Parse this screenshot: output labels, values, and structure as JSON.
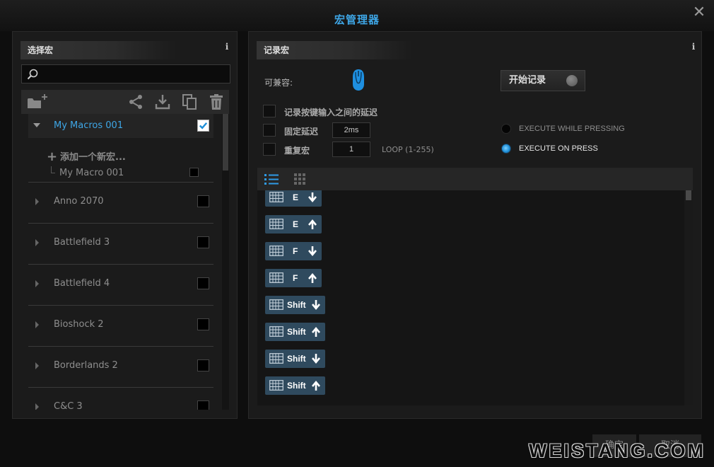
{
  "window": {
    "title": "宏管理器",
    "close": "✕"
  },
  "left": {
    "header": "选择宏",
    "info": "i",
    "search": {
      "value": "",
      "placeholder": ""
    },
    "group": {
      "label": "My Macros 001",
      "checked": true
    },
    "add_macro": "添加一个新宏...",
    "sub_macro": "My Macro 001",
    "games": [
      "Anno 2070",
      "Battlefield 3",
      "Battlefield 4",
      "Bioshock 2",
      "Borderlands 2",
      "C&C 3"
    ]
  },
  "right": {
    "header": "记录宏",
    "info": "i",
    "compat_label": "可兼容:",
    "record_button": "开始记录",
    "opt_record_delay": "记录按键输入之间的延迟",
    "opt_fixed_delay": "固定延迟",
    "fixed_delay_value": "2ms",
    "opt_repeat": "重复宏",
    "repeat_value": "1",
    "loop_label": "LOOP (1-255)",
    "radio_while": "EXECUTE WHILE PRESSING",
    "radio_on_press": "EXECUTE ON PRESS",
    "selected_mode": "EXECUTE ON PRESS",
    "events": [
      {
        "key": "E",
        "dir": "down"
      },
      {
        "key": "E",
        "dir": "up"
      },
      {
        "key": "F",
        "dir": "down"
      },
      {
        "key": "F",
        "dir": "up"
      },
      {
        "key": "Shift",
        "dir": "down"
      },
      {
        "key": "Shift",
        "dir": "up"
      },
      {
        "key": "Shift",
        "dir": "down"
      },
      {
        "key": "Shift",
        "dir": "up"
      }
    ]
  },
  "footer": {
    "ok": "确定",
    "cancel": "取消"
  },
  "watermark": "WEISTANG.COM",
  "colors": {
    "accent": "#3ea6e6",
    "key_pill": "#2f4a5e",
    "panel": "#1b1b1b"
  }
}
